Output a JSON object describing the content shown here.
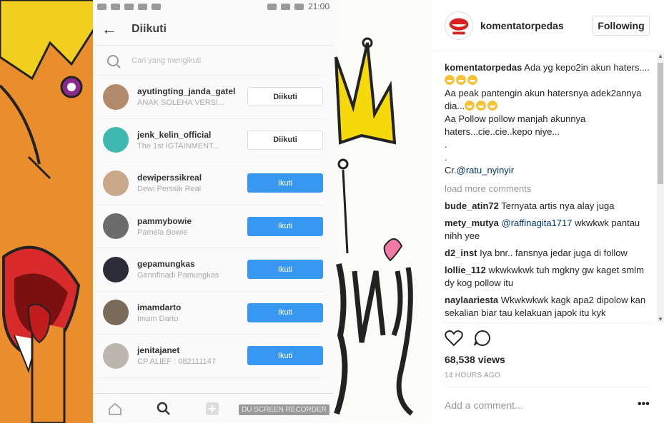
{
  "phone": {
    "status_time": "21:00",
    "title": "Diikuti",
    "search_placeholder": "Cari yang mengikuti",
    "users": [
      {
        "name": "ayutingting_janda_gatel",
        "sub": "ANAK SOLEHA VERSI...",
        "button": "Diikuti",
        "state": "following",
        "avatar_color": "#b08a6a"
      },
      {
        "name": "jenk_kelin_official",
        "sub": "The 1st IGTAINMENT...",
        "button": "Diikuti",
        "state": "following",
        "avatar_color": "#3fb9b0"
      },
      {
        "name": "dewiperssikreal",
        "sub": "Dewi Perssik Real",
        "button": "Ikuti",
        "state": "follow",
        "avatar_color": "#c9a88a"
      },
      {
        "name": "pammybowie",
        "sub": "Pamela Bowie",
        "button": "Ikuti",
        "state": "follow",
        "avatar_color": "#6b6b6b"
      },
      {
        "name": "gepamungkas",
        "sub": "Gennfinadi Pamungkas",
        "button": "Ikuti",
        "state": "follow",
        "avatar_color": "#2d2d3a"
      },
      {
        "name": "imamdarto",
        "sub": "Imam Darto",
        "button": "Ikuti",
        "state": "follow",
        "avatar_color": "#7a6a5a"
      },
      {
        "name": "jenitajanet",
        "sub": "CP ALIEF : 082111147",
        "button": "Ikuti",
        "state": "follow",
        "avatar_color": "#bdb6ae"
      }
    ],
    "recorder_label": "DU SCREEN RECORDER"
  },
  "post": {
    "owner": "komentatorpedas",
    "follow_state": "Following",
    "caption": {
      "user": "komentatorpedas",
      "line1": "Ada yg kepo2in akun haters....",
      "line2": "Aa peak pantengin akun hatersnya adek2annya dia...",
      "line3": "Aa Pollow pollow manjah akunnya haters...cie..cie..kepo niye...",
      "dot1": ".",
      "dot2": ".",
      "credit_prefix": "Cr.",
      "credit_user": "@ratu_nyinyir"
    },
    "load_more": "load more comments",
    "comments": [
      {
        "user": "bude_atin72",
        "text": "Ternyata artis nya alay juga"
      },
      {
        "user": "mety_mutya",
        "mention": "@raffinagita1717",
        "text": "wkwkwk pantau nihh yee"
      },
      {
        "user": "d2_inst",
        "text": "Iya bnr.. fansnya jedar juga di follow"
      },
      {
        "user": "lollie_112",
        "text": "wkwkwkwk tuh mgkny gw kaget smlm dy kog pollow itu"
      },
      {
        "user": "naylaariesta",
        "text": "Wkwkwkwk kagk apa2 dipolow kan sekalian biar tau kelakuan japok itu kyk"
      }
    ],
    "views": "68,538 views",
    "time_ago": "14 HOURS AGO",
    "add_comment_placeholder": "Add a comment...",
    "more_label": "•••"
  },
  "colors": {
    "instagram_blue": "#3897f0",
    "cartoon_orange": "#e88b2c",
    "crown_yellow": "#f5d90a"
  }
}
